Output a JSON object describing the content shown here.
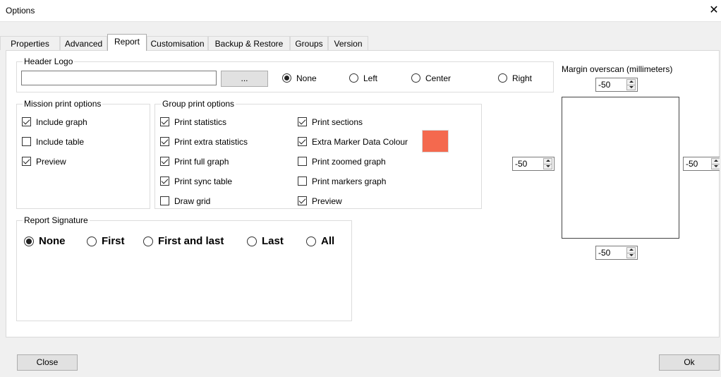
{
  "window": {
    "title": "Options",
    "close_glyph": "✕"
  },
  "tabs": [
    "Properties",
    "Advanced",
    "Report",
    "Customisation",
    "Backup & Restore",
    "Groups",
    "Version"
  ],
  "active_tab": "Report",
  "header_logo": {
    "legend": "Header Logo",
    "path_value": "",
    "browse_label": "...",
    "options": [
      "None",
      "Left",
      "Center",
      "Right"
    ],
    "selected": "None"
  },
  "mission": {
    "legend": "Mission print options",
    "items": [
      {
        "label": "Include graph",
        "checked": true
      },
      {
        "label": "Include table",
        "checked": false
      },
      {
        "label": "Preview",
        "checked": true
      }
    ]
  },
  "group": {
    "legend": "Group print options",
    "col1": [
      {
        "label": "Print statistics",
        "checked": true
      },
      {
        "label": "Print extra statistics",
        "checked": true
      },
      {
        "label": "Print full graph",
        "checked": true
      },
      {
        "label": "Print sync table",
        "checked": true
      },
      {
        "label": "Draw grid",
        "checked": false
      }
    ],
    "col2": [
      {
        "label": "Print sections",
        "checked": true
      },
      {
        "label": "Extra Marker Data Colour",
        "checked": true
      },
      {
        "label": "Print zoomed graph",
        "checked": false
      },
      {
        "label": "Print markers graph",
        "checked": false
      },
      {
        "label": "Preview",
        "checked": true
      }
    ],
    "marker_colour": "#f4694e"
  },
  "signature": {
    "legend": "Report Signature",
    "options": [
      "None",
      "First",
      "First and last",
      "Last",
      "All"
    ],
    "selected": "None"
  },
  "margin": {
    "label": "Margin overscan (millimeters)",
    "top": "-50",
    "left": "-50",
    "right": "-50",
    "bottom": "-50"
  },
  "buttons": {
    "close": "Close",
    "ok": "Ok"
  }
}
